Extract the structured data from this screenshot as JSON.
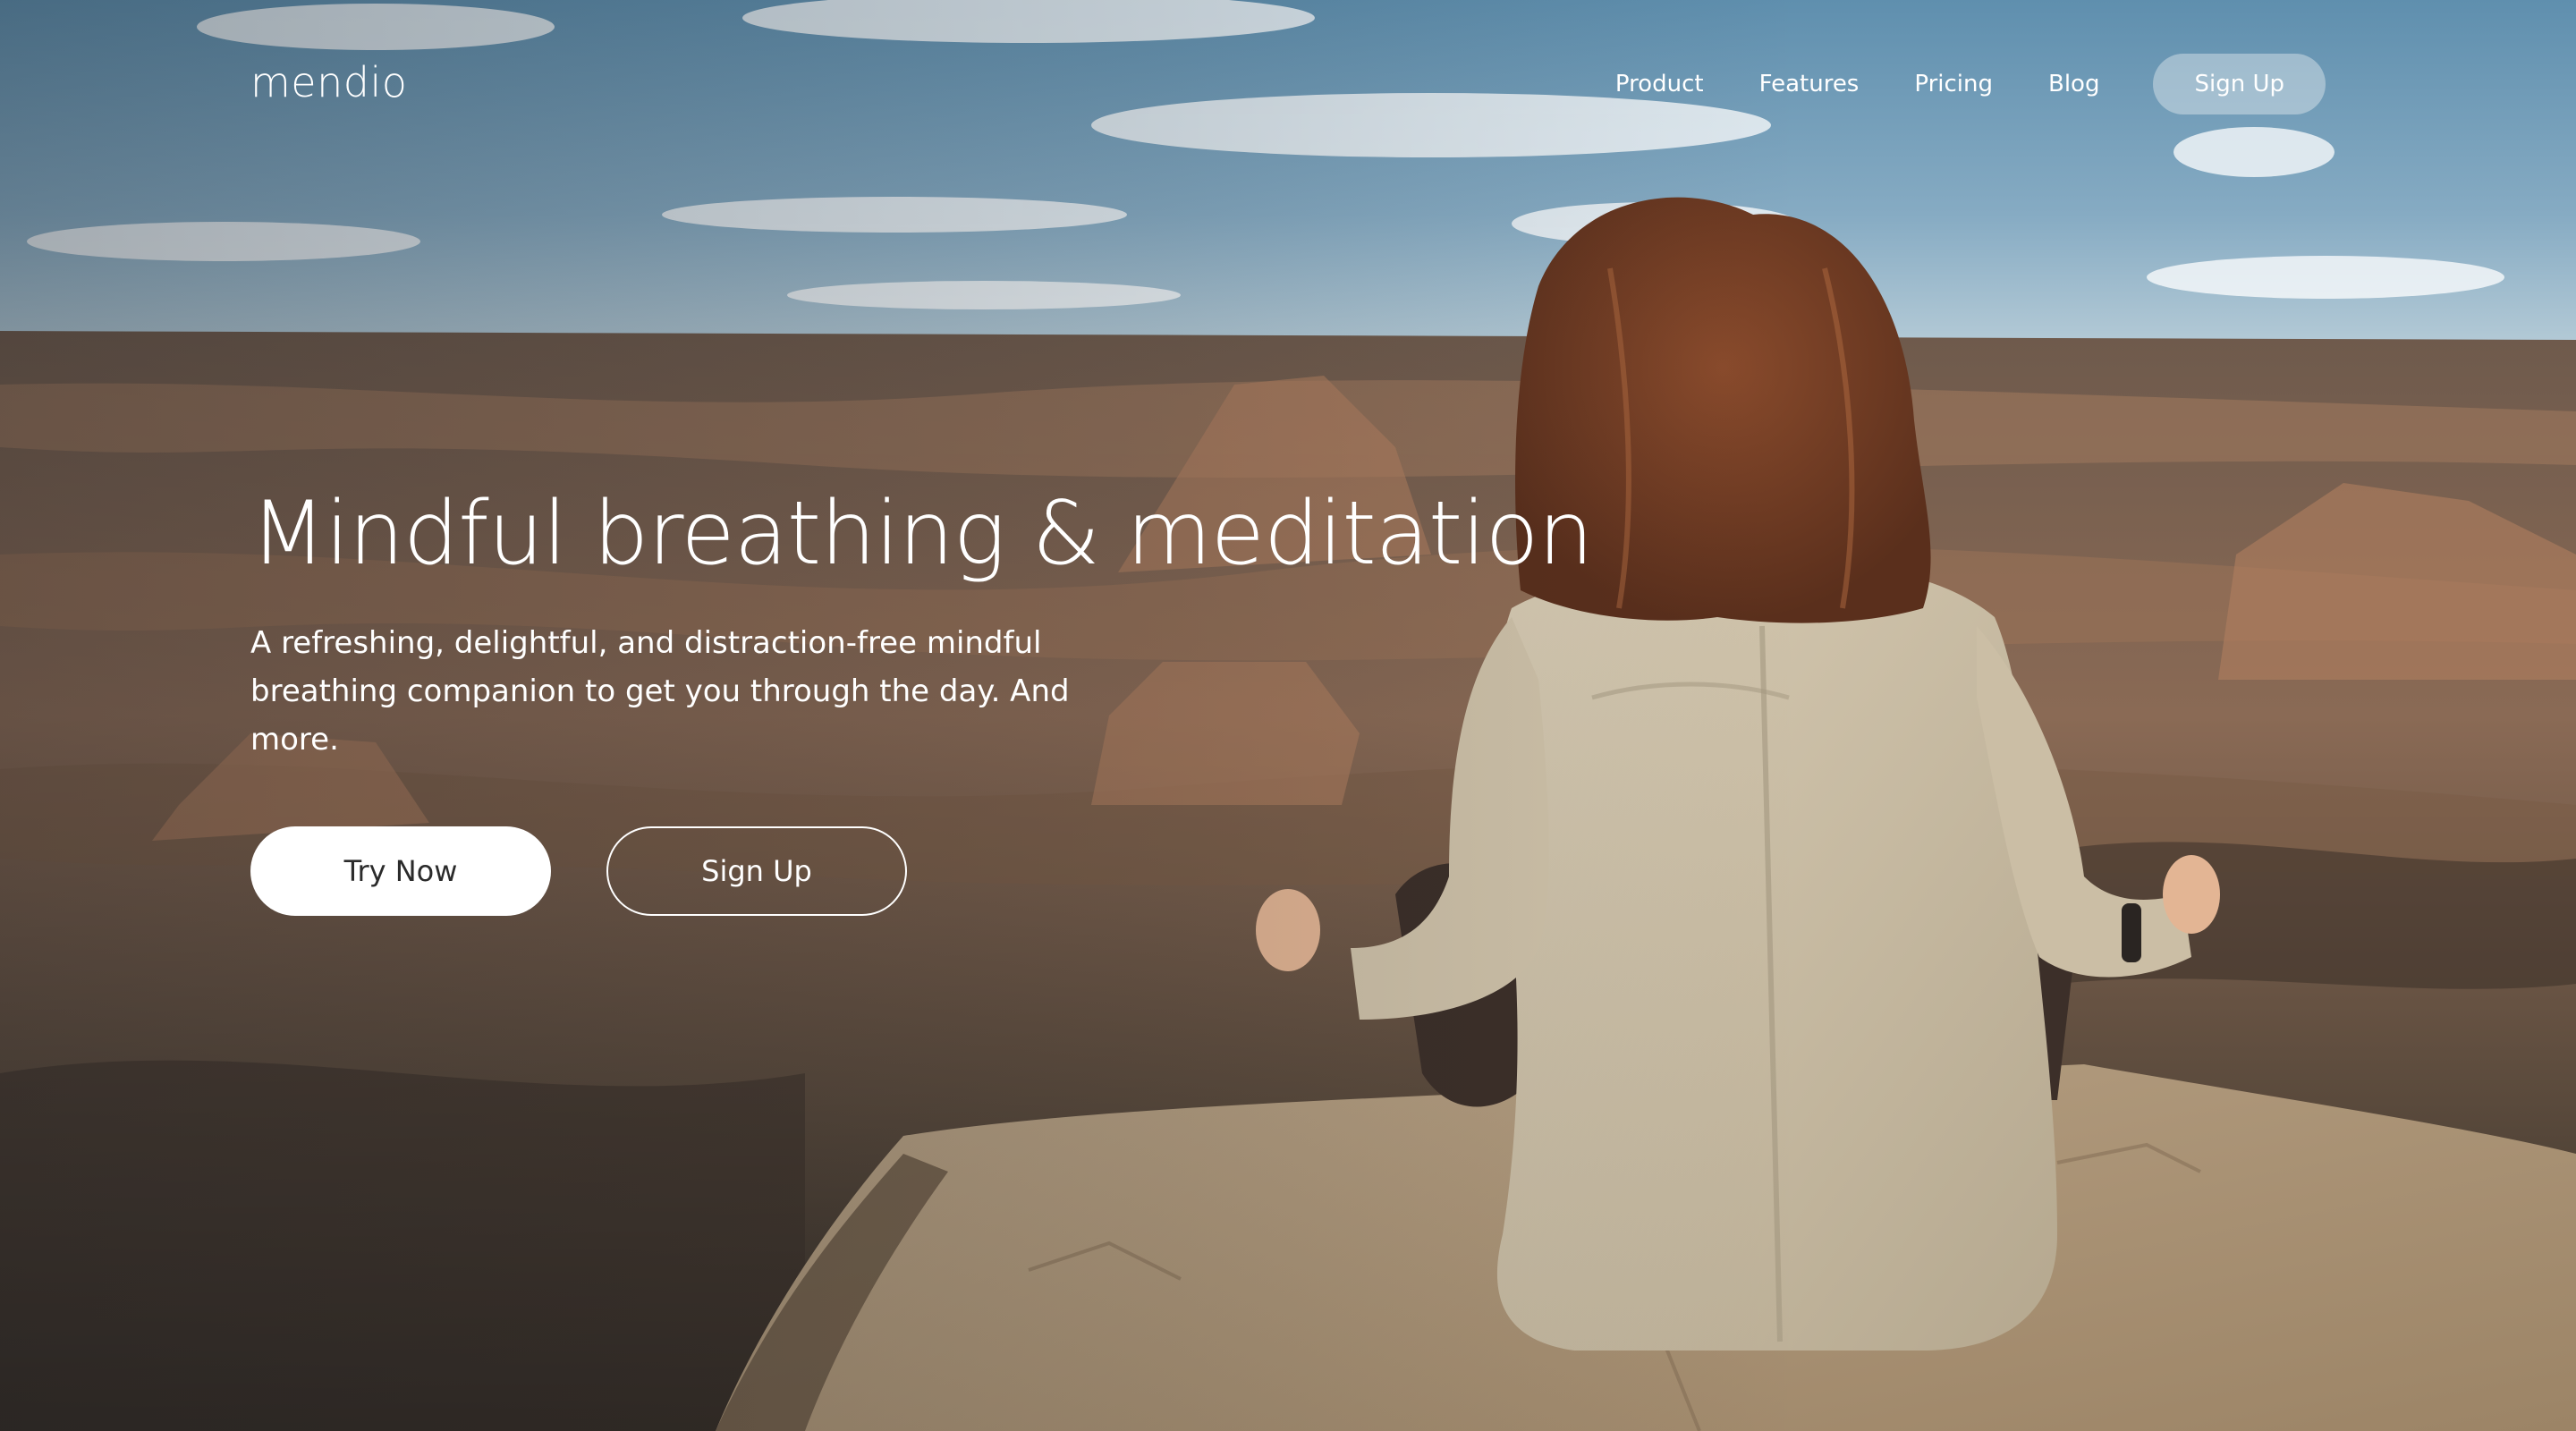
{
  "brand": {
    "logo_text": "mendio"
  },
  "nav": {
    "links": [
      {
        "label": "Product"
      },
      {
        "label": "Features"
      },
      {
        "label": "Pricing"
      },
      {
        "label": "Blog"
      }
    ],
    "signup_label": "Sign Up"
  },
  "hero": {
    "headline": "Mindful breathing & meditation",
    "subtext": "A refreshing, delightful, and distraction-free mindful breathing companion to get you through the day. And more.",
    "primary_cta_label": "Try Now",
    "secondary_cta_label": "Sign Up"
  },
  "theme": {
    "text_color": "#ffffff",
    "primary_button_bg": "#ffffff",
    "primary_button_text": "#2b2b2b",
    "nav_signup_bg": "rgba(235,240,244,0.42)"
  }
}
